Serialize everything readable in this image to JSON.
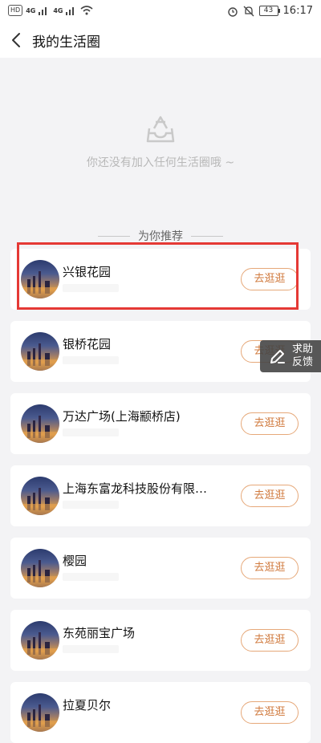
{
  "status_bar": {
    "left_badges": [
      "HD",
      "4G",
      "4G"
    ],
    "battery": "43",
    "time": "16:17"
  },
  "header": {
    "title": "我的生活圈"
  },
  "empty_state": {
    "message": "你还没有加入任何生活圈哦 ~"
  },
  "recommend": {
    "label": "为你推荐"
  },
  "circles": [
    {
      "name": "兴银花园",
      "action": "去逛逛"
    },
    {
      "name": "银桥花园",
      "action": "去逛逛"
    },
    {
      "name": "万达广场(上海颛桥店)",
      "action": "去逛逛"
    },
    {
      "name": "上海东富龙科技股份有限…",
      "action": "去逛逛"
    },
    {
      "name": "樱园",
      "action": "去逛逛"
    },
    {
      "name": "东苑丽宝广场",
      "action": "去逛逛"
    },
    {
      "name": "拉夏贝尔",
      "action": "去逛逛"
    }
  ],
  "help_widget": {
    "line1": "求助",
    "line2": "反馈"
  },
  "colors": {
    "accent_orange": "#d07a3e",
    "highlight_red": "#e53935"
  }
}
